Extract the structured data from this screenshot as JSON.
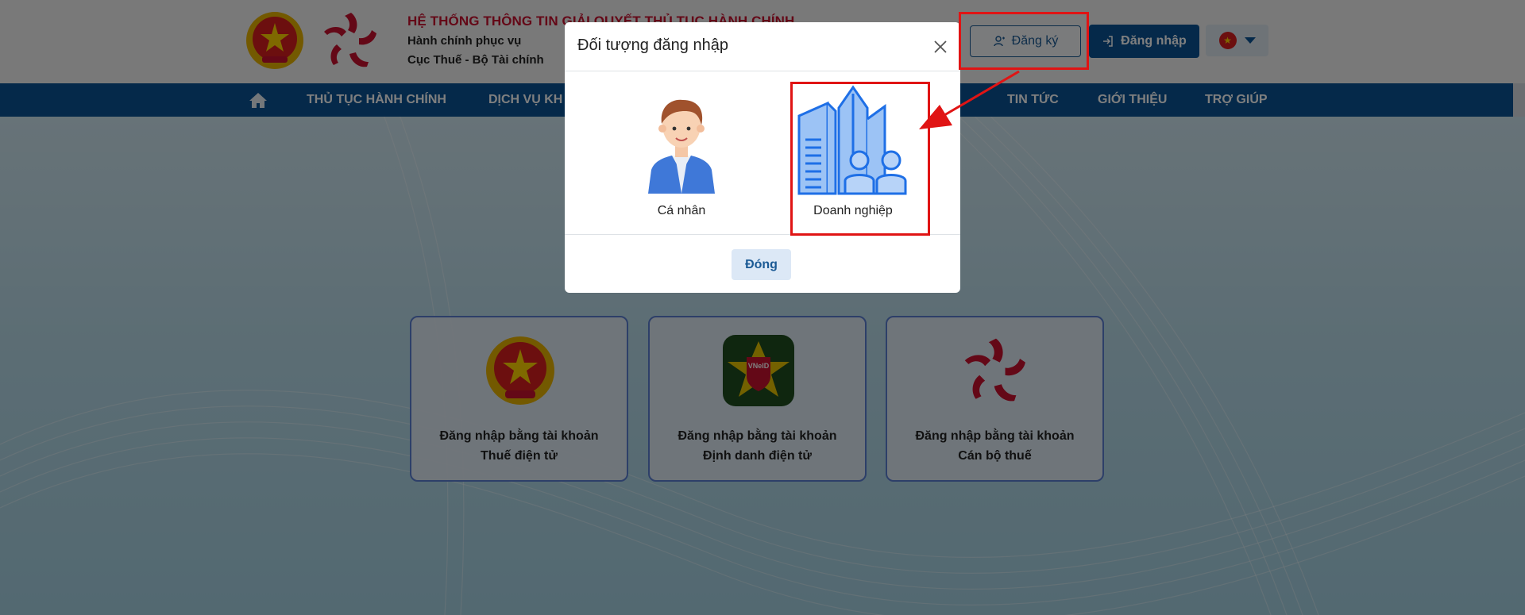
{
  "header": {
    "title": "HỆ THỐNG THÔNG TIN GIẢI QUYẾT THỦ TỤC HÀNH CHÍNH",
    "subtitle_line1": "Hành chính phục vụ",
    "subtitle_line2": "Cục Thuế - Bộ Tài chính",
    "register_label": "Đăng ký",
    "login_label": "Đăng nhập",
    "language": "vi"
  },
  "nav": {
    "items": [
      {
        "label": "THỦ TỤC HÀNH CHÍNH"
      },
      {
        "label": "DỊCH VỤ KH"
      },
      {
        "label": "TIN TỨC"
      },
      {
        "label": "GIỚI THIỆU"
      },
      {
        "label": "TRỢ GIÚP"
      }
    ]
  },
  "login_cards": [
    {
      "line1": "Đăng nhập bằng tài khoản",
      "line2": "Thuế điện tử",
      "icon": "national-emblem-icon"
    },
    {
      "line1": "Đăng nhập bằng tài khoản",
      "line2": "Định danh điện tử",
      "icon": "vneid-icon"
    },
    {
      "line1": "Đăng nhập bằng tài khoản",
      "line2": "Cán bộ thuế",
      "icon": "tax-star-icon"
    }
  ],
  "modal": {
    "title": "Đối tượng đăng nhập",
    "options": [
      {
        "label": "Cá nhân",
        "icon": "person-icon"
      },
      {
        "label": "Doanh nghiệp",
        "icon": "buildings-icon"
      }
    ],
    "close_label": "Đóng"
  },
  "colors": {
    "primary": "#0b5394",
    "title_red": "#c8102e",
    "annotation_red": "#e01414",
    "card_border": "#5b7fd3"
  }
}
